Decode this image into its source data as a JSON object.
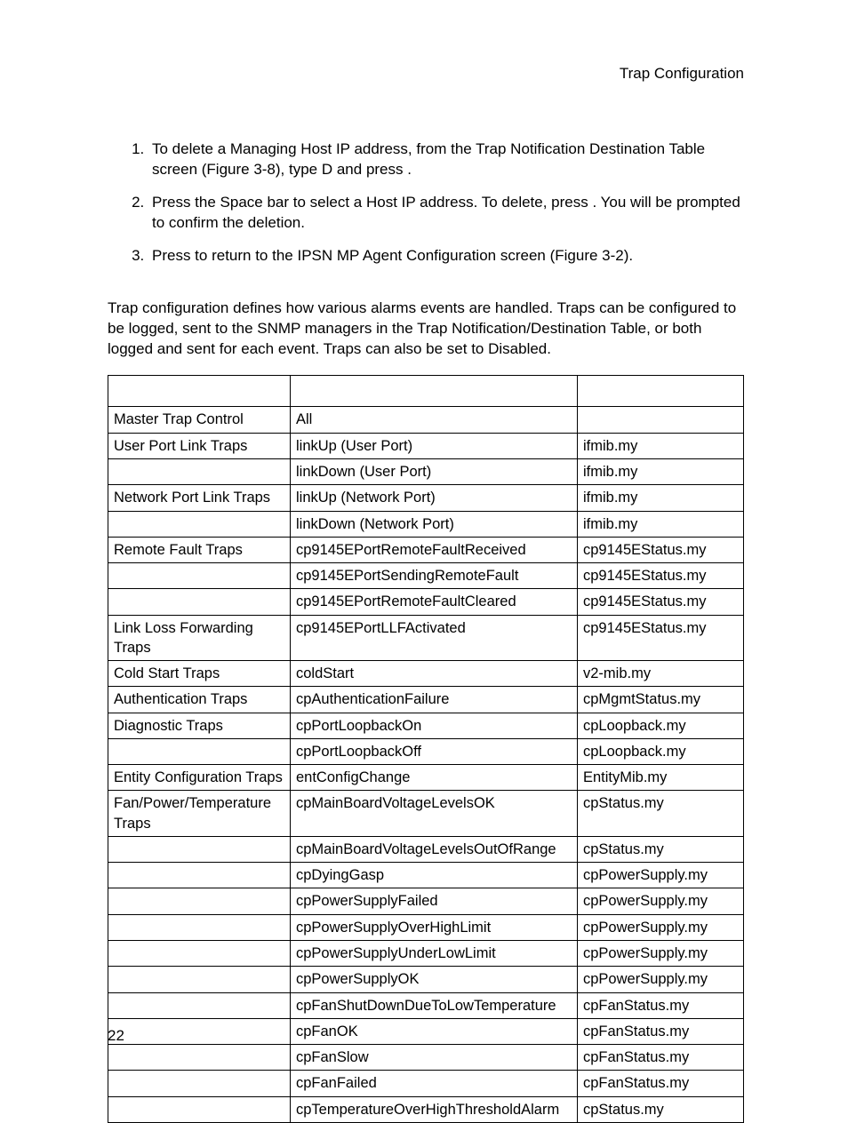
{
  "header": {
    "title": "Trap Configuration"
  },
  "steps": [
    "To delete a Managing Host IP address, from the Trap Notification Destination Table screen (Figure 3-8), type D and press        .",
    "Press the Space bar to select a Host IP address. To delete, press        . You will be prompted to confirm the deletion.",
    "Press        to return to the IPSN MP Agent Configuration screen (Figure 3-2)."
  ],
  "intro": "Trap configuration defines how various alarms events are handled. Traps can be configured to be logged, sent to the SNMP managers in the Trap Notification/Destination Table, or both logged and sent for each event. Traps can also be set to Disabled.",
  "table": {
    "rows": [
      {
        "c0": "Master Trap Control",
        "c1": "All",
        "c2": ""
      },
      {
        "c0": "User Port Link Traps",
        "c1": "linkUp (User Port)",
        "c2": "ifmib.my"
      },
      {
        "c0": "",
        "c1": "linkDown (User Port)",
        "c2": "ifmib.my"
      },
      {
        "c0": "Network Port Link Traps",
        "c1": "linkUp (Network Port)",
        "c2": "ifmib.my"
      },
      {
        "c0": "",
        "c1": "linkDown (Network Port)",
        "c2": "ifmib.my"
      },
      {
        "c0": "Remote Fault Traps",
        "c1": "cp9145EPortRemoteFaultReceived",
        "c2": "cp9145EStatus.my"
      },
      {
        "c0": "",
        "c1": "cp9145EPortSendingRemoteFault",
        "c2": "cp9145EStatus.my"
      },
      {
        "c0": "",
        "c1": "cp9145EPortRemoteFaultCleared",
        "c2": "cp9145EStatus.my"
      },
      {
        "c0": "Link Loss Forwarding Traps",
        "c1": "cp9145EPortLLFActivated",
        "c2": "cp9145EStatus.my"
      },
      {
        "c0": "Cold Start Traps",
        "c1": "coldStart",
        "c2": "v2-mib.my"
      },
      {
        "c0": "Authentication Traps",
        "c1": "cpAuthenticationFailure",
        "c2": "cpMgmtStatus.my"
      },
      {
        "c0": "Diagnostic Traps",
        "c1": "cpPortLoopbackOn",
        "c2": "cpLoopback.my"
      },
      {
        "c0": "",
        "c1": "cpPortLoopbackOff",
        "c2": "cpLoopback.my"
      },
      {
        "c0": "Entity Configuration Traps",
        "c1": "entConfigChange",
        "c2": "EntityMib.my"
      },
      {
        "c0": "Fan/Power/Temperature Traps",
        "c1": "cpMainBoardVoltageLevelsOK",
        "c2": "cpStatus.my"
      },
      {
        "c0": "",
        "c1": "cpMainBoardVoltageLevelsOutOfRange",
        "c2": "cpStatus.my"
      },
      {
        "c0": "",
        "c1": "cpDyingGasp",
        "c2": "cpPowerSupply.my"
      },
      {
        "c0": "",
        "c1": "cpPowerSupplyFailed",
        "c2": "cpPowerSupply.my"
      },
      {
        "c0": "",
        "c1": "cpPowerSupplyOverHighLimit",
        "c2": "cpPowerSupply.my"
      },
      {
        "c0": "",
        "c1": "cpPowerSupplyUnderLowLimit",
        "c2": "cpPowerSupply.my"
      },
      {
        "c0": "",
        "c1": "cpPowerSupplyOK",
        "c2": "cpPowerSupply.my"
      },
      {
        "c0": "",
        "c1": "cpFanShutDownDueToLowTemperature",
        "c2": "cpFanStatus.my"
      },
      {
        "c0": "",
        "c1": "cpFanOK",
        "c2": "cpFanStatus.my"
      },
      {
        "c0": "",
        "c1": "cpFanSlow",
        "c2": "cpFanStatus.my"
      },
      {
        "c0": "",
        "c1": "cpFanFailed",
        "c2": "cpFanStatus.my"
      },
      {
        "c0": "",
        "c1": "cpTemperatureOverHighThresholdAlarm",
        "c2": "cpStatus.my"
      }
    ]
  },
  "page_number": "22"
}
